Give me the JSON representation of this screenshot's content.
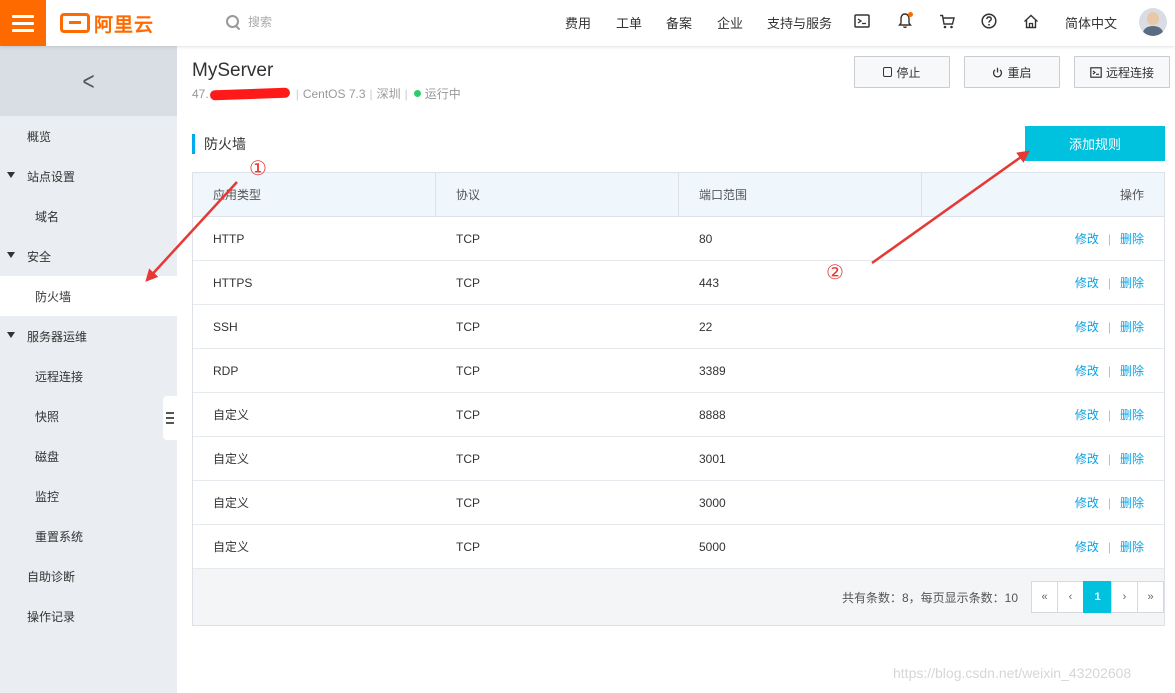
{
  "topbar": {
    "logo_text": "阿里云",
    "search_placeholder": "搜索",
    "nav": [
      "费用",
      "工单",
      "备案",
      "企业",
      "支持与服务"
    ],
    "language": "简体中文"
  },
  "sidebar": {
    "items": [
      {
        "label": "概览"
      },
      {
        "label": "站点设置"
      },
      {
        "label": "域名"
      },
      {
        "label": "安全"
      },
      {
        "label": "防火墙"
      },
      {
        "label": "服务器运维"
      },
      {
        "label": "远程连接"
      },
      {
        "label": "快照"
      },
      {
        "label": "磁盘"
      },
      {
        "label": "监控"
      },
      {
        "label": "重置系统"
      },
      {
        "label": "自助诊断"
      },
      {
        "label": "操作记录"
      }
    ]
  },
  "server": {
    "name": "MyServer",
    "ip_prefix": "47.",
    "os": "CentOS 7.3",
    "region": "深圳",
    "status": "运行中"
  },
  "actions": {
    "stop": "停止",
    "restart": "重启",
    "remote": "远程连接"
  },
  "firewall": {
    "title": "防火墙",
    "add_rule": "添加规则",
    "columns": [
      "应用类型",
      "协议",
      "端口范围",
      "操作"
    ],
    "edit_label": "修改",
    "delete_label": "删除",
    "rows": [
      {
        "type": "HTTP",
        "protocol": "TCP",
        "port": "80"
      },
      {
        "type": "HTTPS",
        "protocol": "TCP",
        "port": "443"
      },
      {
        "type": "SSH",
        "protocol": "TCP",
        "port": "22"
      },
      {
        "type": "RDP",
        "protocol": "TCP",
        "port": "3389"
      },
      {
        "type": "自定义",
        "protocol": "TCP",
        "port": "8888"
      },
      {
        "type": "自定义",
        "protocol": "TCP",
        "port": "3001"
      },
      {
        "type": "自定义",
        "protocol": "TCP",
        "port": "3000"
      },
      {
        "type": "自定义",
        "protocol": "TCP",
        "port": "5000"
      }
    ],
    "footer_text": "共有条数：8，每页显示条数：10",
    "pager": {
      "first": "«",
      "prev": "‹",
      "current": "1",
      "next": "›",
      "last": "»"
    }
  },
  "annotations": {
    "marker1": "①",
    "marker2": "②",
    "color": "#e53935"
  },
  "watermark": "https://blog.csdn.net/weixin_43202608",
  "colors": {
    "brand": "#ff6a00",
    "accent": "#00c1de",
    "link": "#0aa3e4",
    "status_running": "#2ecc71"
  }
}
